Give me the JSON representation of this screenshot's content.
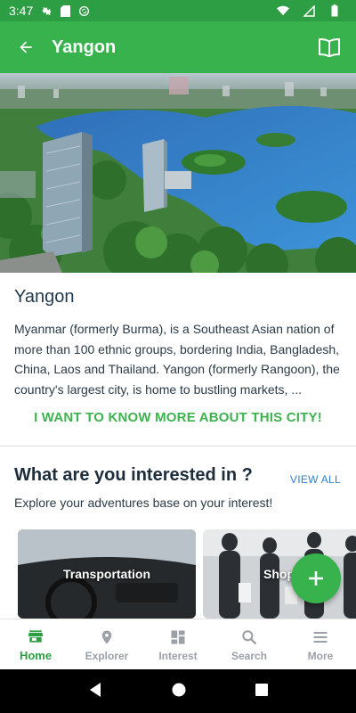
{
  "status_bar": {
    "time": "3:47"
  },
  "app_bar": {
    "title": "Yangon"
  },
  "intro": {
    "city_name": "Yangon",
    "description": "Myanmar (formerly Burma), is a Southeast Asian nation of more than 100 ethnic groups, bordering India, Bangladesh, China, Laos and Thailand. Yangon (formerly Rangoon), the country's largest city, is home to bustling markets, ...",
    "more_link": "I WANT TO KNOW MORE ABOUT THIS CITY!"
  },
  "interests": {
    "title": "What are you interested in ?",
    "view_all": "VIEW ALL",
    "subtitle": "Explore your adventures base on your interest!",
    "cards": [
      {
        "label": "Transportation"
      },
      {
        "label": "Shop"
      }
    ]
  },
  "bottom_nav": {
    "items": [
      {
        "label": "Home",
        "icon": "store-icon",
        "active": true
      },
      {
        "label": "Explorer",
        "icon": "location-pin-icon",
        "active": false
      },
      {
        "label": "Interest",
        "icon": "dashboard-icon",
        "active": false
      },
      {
        "label": "Search",
        "icon": "search-icon",
        "active": false
      },
      {
        "label": "More",
        "icon": "menu-icon",
        "active": false
      }
    ]
  },
  "colors": {
    "primary": "#37b24d",
    "status_bar": "#2e9e45",
    "link": "#2f7fd1",
    "inactive": "#9aa0a6"
  }
}
